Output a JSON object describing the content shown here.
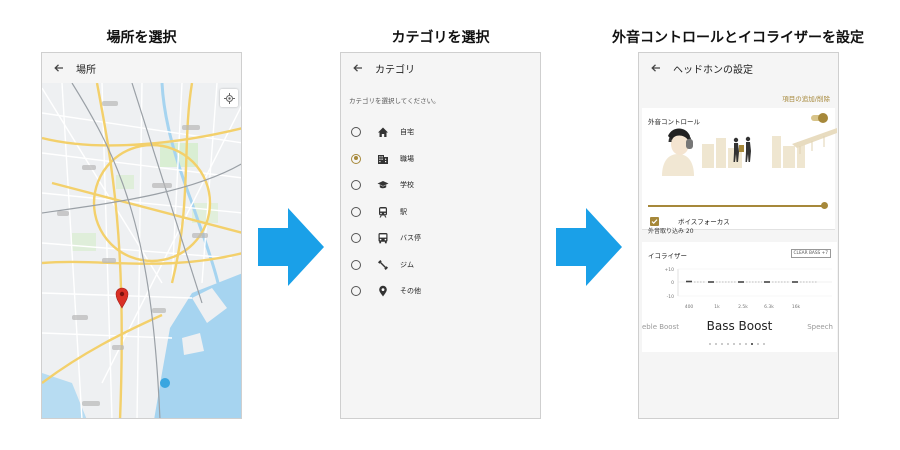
{
  "steps": [
    {
      "title": "場所を選択"
    },
    {
      "title": "カテゴリを選択"
    },
    {
      "title": "外音コントロールとイコライザーを設定"
    }
  ],
  "screen1": {
    "app_title": "場所"
  },
  "screen2": {
    "app_title": "カテゴリ",
    "hint": "カテゴリを選択してください。",
    "selected": "職場",
    "categories": [
      {
        "label": "自宅",
        "icon": "home-icon"
      },
      {
        "label": "職場",
        "icon": "office-building-icon"
      },
      {
        "label": "学校",
        "icon": "school-cap-icon"
      },
      {
        "label": "駅",
        "icon": "train-icon"
      },
      {
        "label": "バス停",
        "icon": "bus-icon"
      },
      {
        "label": "ジム",
        "icon": "dumbbell-icon"
      },
      {
        "label": "その他",
        "icon": "place-pin-icon"
      }
    ]
  },
  "screen3": {
    "app_title": "ヘッドホンの設定",
    "add_remove_link": "項目の追加/削除",
    "ambient": {
      "title": "外音コントロール",
      "enabled": true,
      "level_label": "外音取り込み 20",
      "level": 20,
      "level_max": 20,
      "voice_focus_label": "ボイスフォーカス",
      "voice_focus_checked": true
    },
    "equalizer": {
      "title": "イコライザー",
      "clear_bass": "CLEAR BASS  +7",
      "y_ticks": [
        "+10",
        "0",
        "-10"
      ],
      "bands": [
        "400",
        "1k",
        "2.5k",
        "6.3k",
        "16k"
      ],
      "preset_prev": "eble Boost",
      "preset_current": "Bass Boost",
      "preset_next": "Speech",
      "page_count": 10,
      "active_page": 7
    }
  },
  "colors": {
    "accent_gold": "#a6883a",
    "arrow_blue": "#1aa0e8",
    "map_pin_red": "#d93025"
  }
}
